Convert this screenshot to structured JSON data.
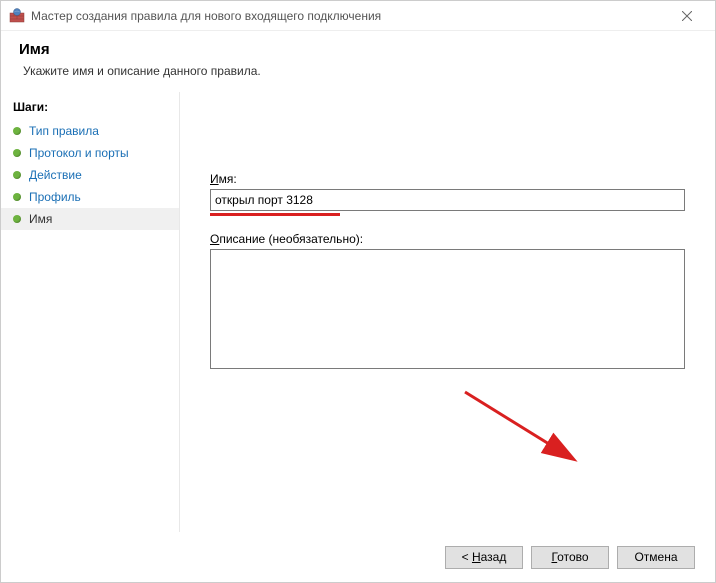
{
  "window": {
    "title": "Мастер создания правила для нового входящего подключения"
  },
  "header": {
    "title": "Имя",
    "subtitle": "Укажите имя и описание данного правила."
  },
  "sidebar": {
    "heading": "Шаги:",
    "items": [
      {
        "label": "Тип правила"
      },
      {
        "label": "Протокол и порты"
      },
      {
        "label": "Действие"
      },
      {
        "label": "Профиль"
      },
      {
        "label": "Имя"
      }
    ]
  },
  "form": {
    "name_label_u": "И",
    "name_label_rest": "мя:",
    "name_value": "открыл порт 3128",
    "desc_label_u": "О",
    "desc_label_rest": "писание (необязательно):",
    "desc_value": ""
  },
  "buttons": {
    "back_prefix": "< ",
    "back_u": "Н",
    "back_rest": "азад",
    "finish_u": "Г",
    "finish_rest": "отово",
    "cancel": "Отмена"
  }
}
